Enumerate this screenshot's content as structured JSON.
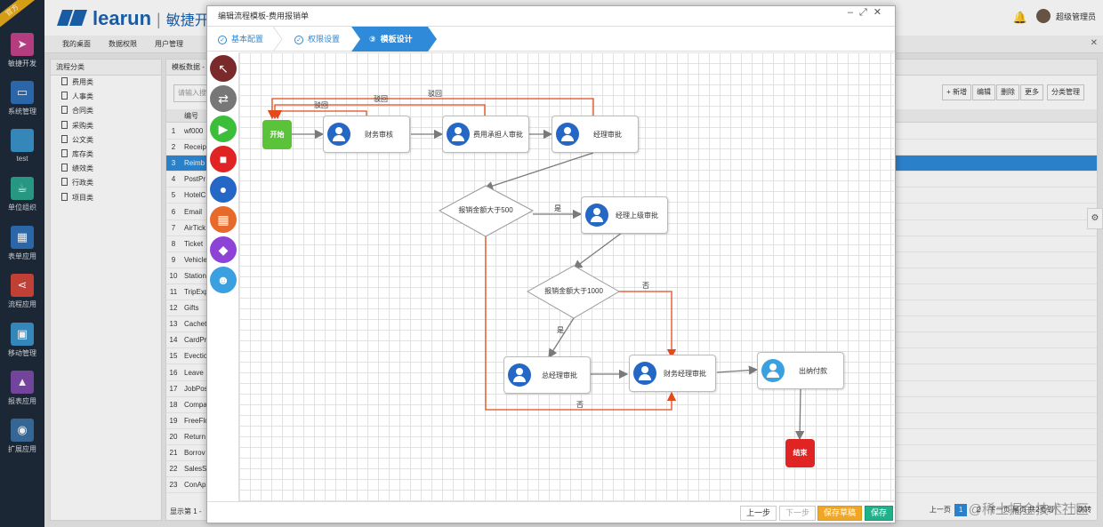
{
  "brand": {
    "name": "learun",
    "slogan": "敏捷开",
    "ribbon": "官方"
  },
  "user": {
    "name": "超级管理员"
  },
  "sidebar": [
    {
      "label": "敏捷开发",
      "icon": "send-icon",
      "color": "#c2428a"
    },
    {
      "label": "系统管理",
      "icon": "monitor-icon",
      "color": "#2f6eb5"
    },
    {
      "label": "test",
      "icon": "blank-icon",
      "color": "#3a91c7"
    },
    {
      "label": "单位组织",
      "icon": "coffee-icon",
      "color": "#2aa38b"
    },
    {
      "label": "表单应用",
      "icon": "table-icon",
      "color": "#2f6eb5"
    },
    {
      "label": "流程应用",
      "icon": "share-icon",
      "color": "#d0453b"
    },
    {
      "label": "移动管理",
      "icon": "android-icon",
      "color": "#3a91c7"
    },
    {
      "label": "报表应用",
      "icon": "chart-icon",
      "color": "#7b4aa8"
    },
    {
      "label": "扩展应用",
      "icon": "globe-icon",
      "color": "#3a6ea0"
    }
  ],
  "tabs": [
    "我的桌面",
    "数据权限",
    "用户管理"
  ],
  "categories": {
    "title": "流程分类",
    "items": [
      "费用类",
      "人事类",
      "合同类",
      "采购类",
      "公文类",
      "库存类",
      "绩效类",
      "行政类",
      "项目类"
    ]
  },
  "grid": {
    "title": "模板数据 -",
    "search_placeholder": "请输入搜",
    "col_no": "编号",
    "rows": [
      {
        "n": "1",
        "code": "wf000"
      },
      {
        "n": "2",
        "code": "Receip"
      },
      {
        "n": "3",
        "code": "Reimb"
      },
      {
        "n": "4",
        "code": "PostPr"
      },
      {
        "n": "5",
        "code": "HotelC"
      },
      {
        "n": "6",
        "code": "Email"
      },
      {
        "n": "7",
        "code": "AirTick"
      },
      {
        "n": "8",
        "code": "Ticket"
      },
      {
        "n": "9",
        "code": "Vehicle"
      },
      {
        "n": "10",
        "code": "Station"
      },
      {
        "n": "11",
        "code": "TripExp"
      },
      {
        "n": "12",
        "code": "Gifts"
      },
      {
        "n": "13",
        "code": "Cachet"
      },
      {
        "n": "14",
        "code": "CardPr"
      },
      {
        "n": "15",
        "code": "Evectio"
      },
      {
        "n": "16",
        "code": "Leave"
      },
      {
        "n": "17",
        "code": "JobPos"
      },
      {
        "n": "18",
        "code": "Compa"
      },
      {
        "n": "19",
        "code": "FreeFlo"
      },
      {
        "n": "20",
        "code": "Return"
      },
      {
        "n": "21",
        "code": "Borrov"
      },
      {
        "n": "22",
        "code": "SalesS"
      },
      {
        "n": "23",
        "code": "ConAp"
      }
    ],
    "footer": "显示第 1 -",
    "toolbar": [
      "+ 新增",
      "编辑",
      "删除",
      "更多",
      "分类管理"
    ],
    "pager": {
      "prev": "上一页",
      "p1": "1",
      "p2": "2",
      "next": "下一页",
      "last": "尾页",
      "total": "共2页到",
      "go": "跳转"
    }
  },
  "watermark": "@稀土掘金技术社区",
  "modal": {
    "title": "编辑流程模板-费用报销单",
    "steps": [
      "基本配置",
      "权限设置",
      "模板设计"
    ],
    "step3_num": "③",
    "buttons": {
      "prev": "上一步",
      "next": "下一步",
      "draft": "保存草稿",
      "save": "保存"
    }
  },
  "tools": [
    {
      "icon": "arrow-pointer-icon",
      "color": "#7a2a2a"
    },
    {
      "icon": "swap-icon",
      "color": "#777777"
    },
    {
      "icon": "play-icon",
      "color": "#3bbf3b"
    },
    {
      "icon": "stop-icon",
      "color": "#e02424"
    },
    {
      "icon": "user-icon",
      "color": "#2567c5"
    },
    {
      "icon": "grid-icon",
      "color": "#e86a2a"
    },
    {
      "icon": "diamond-icon",
      "color": "#8d44d6"
    },
    {
      "icon": "person-icon",
      "color": "#3aa0e0"
    }
  ],
  "flow": {
    "start": "开始",
    "end": "结束",
    "n_finance": "财务审核",
    "n_cost_owner": "费用承担人审批",
    "n_manager": "经理审批",
    "n_upper_manager": "经理上级审批",
    "n_gm": "总经理审批",
    "n_finance_mgr": "财务经理审批",
    "n_cashier": "出纳付款",
    "d_500": "报销金额大于500",
    "d_1000": "报销金额大于1000",
    "lbl_reject1": "驳回",
    "lbl_reject2": "驳回",
    "lbl_reject3": "驳回",
    "lbl_yes1": "是",
    "lbl_yes2": "是",
    "lbl_no1": "否",
    "lbl_no2": "否"
  }
}
